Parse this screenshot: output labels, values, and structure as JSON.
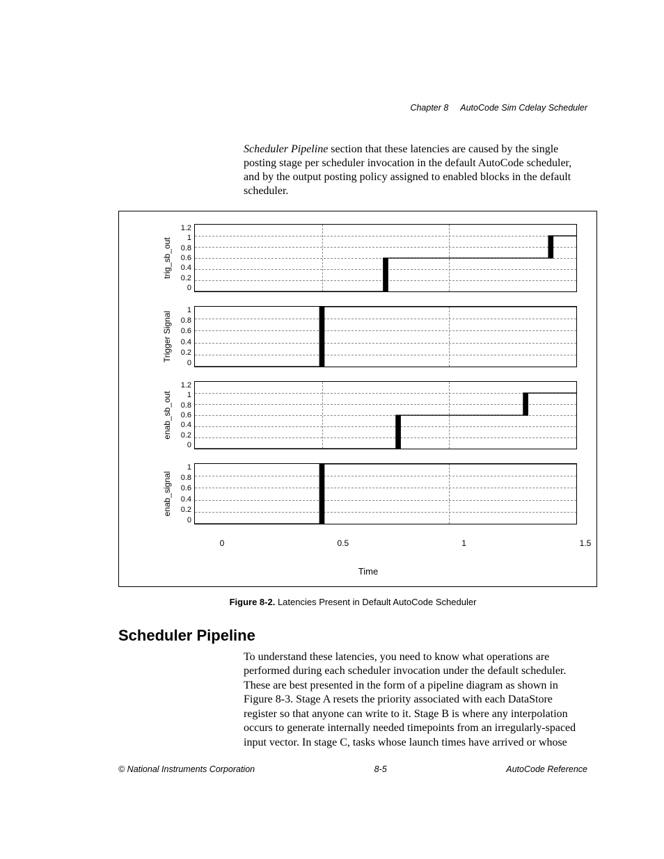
{
  "header": {
    "chapter": "Chapter 8",
    "title": "AutoCode Sim Cdelay Scheduler"
  },
  "intro": {
    "fragment_emph": "Scheduler Pipeline",
    "fragment_rest": " section that these latencies are caused by the single posting stage per scheduler invocation in the default AutoCode scheduler, and by the output posting policy assigned to enabled blocks in the default scheduler."
  },
  "figure": {
    "xlabel": "Time",
    "xticks": [
      "0",
      "0.5",
      "1",
      "1.5"
    ],
    "caption_strong": "Figure 8-2.",
    "caption_rest": "  Latencies Present in Default AutoCode Scheduler",
    "panels": [
      {
        "ylabel": "trig_sb_out",
        "yticks": [
          "1.2",
          "1",
          "0.8",
          "0.6",
          "0.4",
          "0.2",
          "0"
        ]
      },
      {
        "ylabel": "Trigger Signal",
        "yticks": [
          "1",
          "0.8",
          "0.6",
          "0.4",
          "0.2",
          "0"
        ]
      },
      {
        "ylabel": "enab_sb_out",
        "yticks": [
          "1.2",
          "1",
          "0.8",
          "0.6",
          "0.4",
          "0.2",
          "0"
        ]
      },
      {
        "ylabel": "enab_signal",
        "yticks": [
          "1",
          "0.8",
          "0.6",
          "0.4",
          "0.2",
          "0"
        ]
      }
    ]
  },
  "section": {
    "heading": "Scheduler Pipeline",
    "para": "To understand these latencies, you need to know what operations are performed during each scheduler invocation under the default scheduler. These are best presented in the form of a pipeline diagram as shown in Figure 8-3. Stage A resets the priority associated with each DataStore register so that anyone can write to it. Stage B is where any interpolation occurs to generate internally needed timepoints from an irregularly-spaced input vector. In stage C, tasks whose launch times have arrived or whose"
  },
  "footer": {
    "left": "© National Instruments Corporation",
    "center": "8-5",
    "right": "AutoCode Reference"
  },
  "chart_data": [
    {
      "type": "line",
      "title": "trig_sb_out",
      "xlabel": "Time",
      "ylabel": "trig_sb_out",
      "xlim": [
        0,
        1.5
      ],
      "ylim": [
        0,
        1.2
      ],
      "series": [
        {
          "name": "trig_sb_out",
          "x": [
            0,
            0.75,
            0.75,
            1.4,
            1.4,
            1.5
          ],
          "y": [
            0,
            0,
            0.6,
            0.6,
            1,
            1
          ]
        }
      ]
    },
    {
      "type": "line",
      "title": "Trigger Signal",
      "xlabel": "Time",
      "ylabel": "Trigger Signal",
      "xlim": [
        0,
        1.5
      ],
      "ylim": [
        0,
        1.0
      ],
      "series": [
        {
          "name": "Trigger Signal",
          "x": [
            0,
            0.5,
            0.5,
            1.5
          ],
          "y": [
            0,
            0,
            1,
            1
          ]
        }
      ]
    },
    {
      "type": "line",
      "title": "enab_sb_out",
      "xlabel": "Time",
      "ylabel": "enab_sb_out",
      "xlim": [
        0,
        1.5
      ],
      "ylim": [
        0,
        1.2
      ],
      "series": [
        {
          "name": "enab_sb_out",
          "x": [
            0,
            0.8,
            0.8,
            1.3,
            1.3,
            1.5
          ],
          "y": [
            0,
            0,
            0.6,
            0.6,
            1,
            1
          ]
        }
      ]
    },
    {
      "type": "line",
      "title": "enab_signal",
      "xlabel": "Time",
      "ylabel": "enab_signal",
      "xlim": [
        0,
        1.5
      ],
      "ylim": [
        0,
        1.0
      ],
      "series": [
        {
          "name": "enab_signal",
          "x": [
            0,
            0.5,
            0.5,
            1.5
          ],
          "y": [
            0,
            0,
            1,
            1
          ]
        }
      ]
    }
  ]
}
